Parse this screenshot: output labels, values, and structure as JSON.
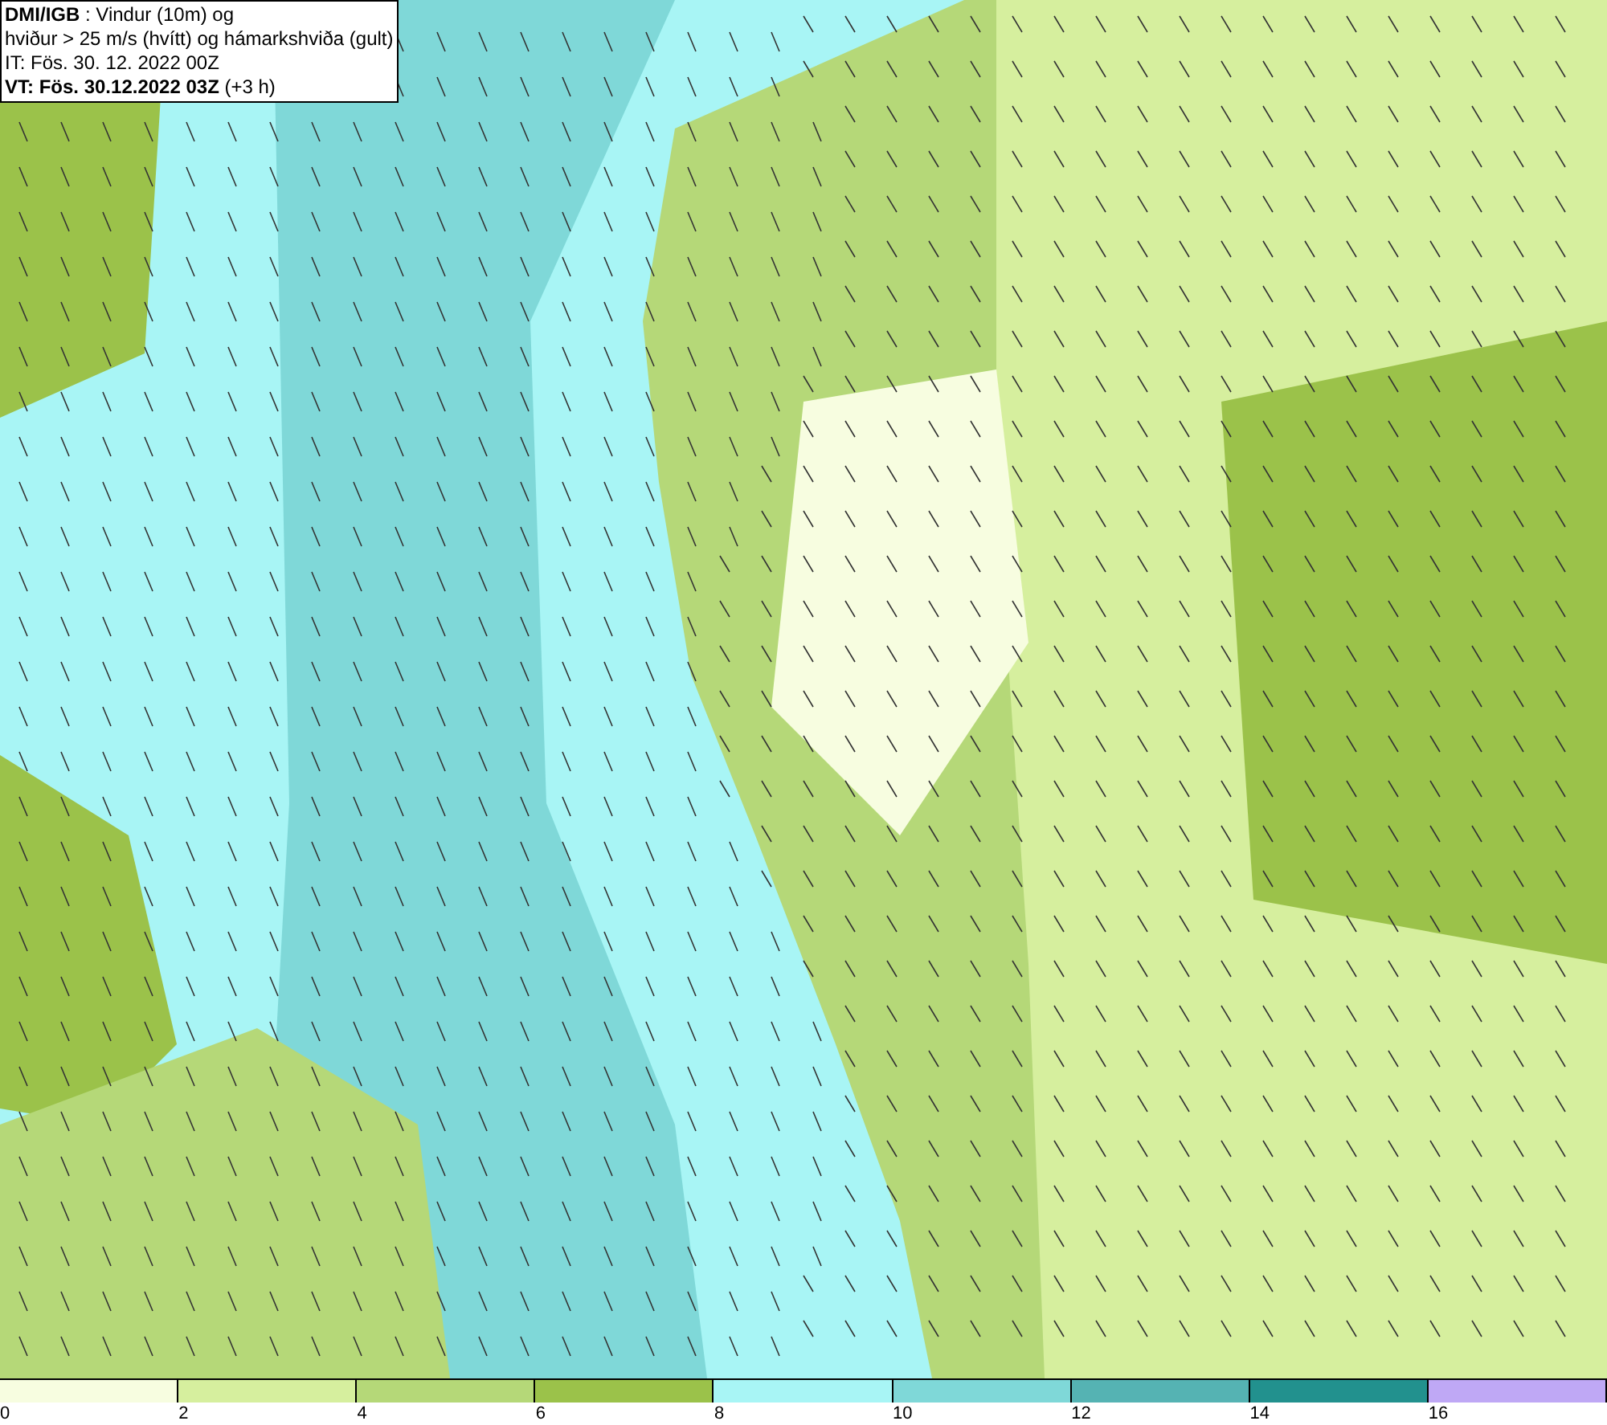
{
  "title_box": {
    "lines": [
      "**DMI/IGB** : Vindur (10m) og",
      "hviður > 25 m/s (hvítt) og hámarkshviða (gult)",
      "IT: Fös. 30. 12. 2022 00Z",
      "**VT: Fös. 30.12.2022 03Z** (+3 h)"
    ]
  },
  "legend": {
    "bins": [
      {
        "label": "0",
        "color": "#f7fde0"
      },
      {
        "label": "2",
        "color": "#d6ef9e"
      },
      {
        "label": "4",
        "color": "#b5d878"
      },
      {
        "label": "6",
        "color": "#9bc24a"
      },
      {
        "label": "8",
        "color": "#a8f5f5"
      },
      {
        "label": "10",
        "color": "#7fd8d8"
      },
      {
        "label": "12",
        "color": "#55b3b3"
      },
      {
        "label": "14",
        "color": "#22918e"
      },
      {
        "label": "16",
        "color": "#bfa8f5"
      }
    ]
  }
}
